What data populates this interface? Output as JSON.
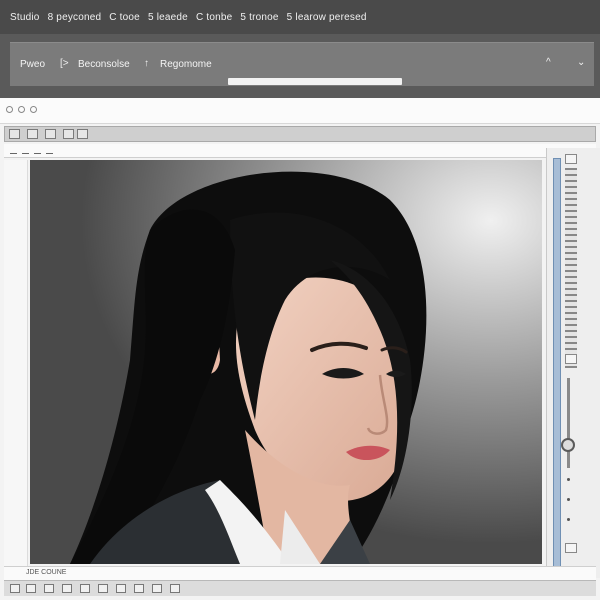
{
  "menu": [
    "Studio",
    "8 peyconed",
    "C tooe",
    "5 leaede",
    "C tonbe",
    "5 tronoe",
    "5 learow peresed"
  ],
  "breadcrumb": {
    "items": [
      "Pweo",
      "Beconsolse",
      "Regomome"
    ],
    "separators": [
      "[>",
      "↑"
    ]
  },
  "controls": {
    "up": "^",
    "down": "⌄"
  },
  "status": {
    "text": "JDE COUNE"
  },
  "image": {
    "description": "portrait"
  },
  "colors": {
    "menubar": "#4a4a4a",
    "accent": "#6f8fb3"
  }
}
